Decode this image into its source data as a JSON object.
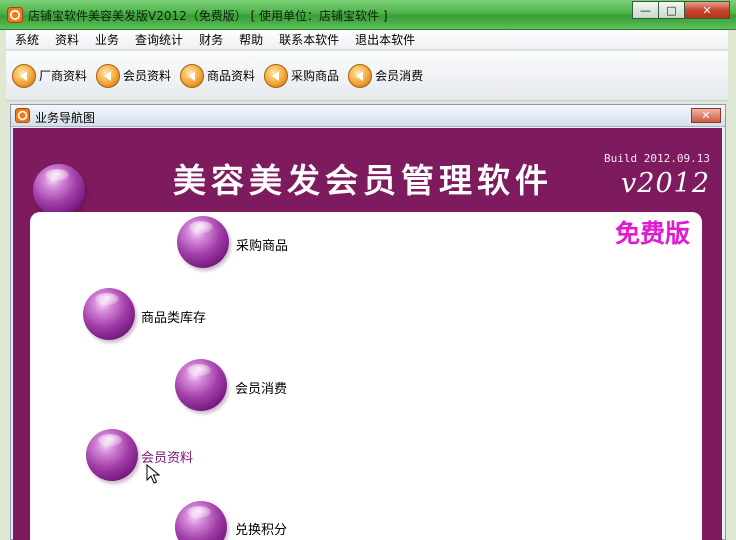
{
  "window": {
    "title": "店铺宝软件美容美发版V2012（免费版）   [ 使用单位：店铺宝软件 ]",
    "minimize_glyph": "—",
    "maximize_glyph": "□",
    "close_glyph": "✕"
  },
  "menu": [
    {
      "label": "系统"
    },
    {
      "label": "资料"
    },
    {
      "label": "业务"
    },
    {
      "label": "查询统计"
    },
    {
      "label": "财务"
    },
    {
      "label": "帮助"
    },
    {
      "label": "联系本软件"
    },
    {
      "label": "退出本软件"
    }
  ],
  "toolbar": [
    {
      "label": "厂商资料",
      "icon": "orange-arrow-icon"
    },
    {
      "label": "会员资料",
      "icon": "orange-arrow-icon"
    },
    {
      "label": "商品资料",
      "icon": "orange-arrow-icon"
    },
    {
      "label": "采购商品",
      "icon": "orange-arrow-icon"
    },
    {
      "label": "会员消费",
      "icon": "orange-arrow-icon"
    }
  ],
  "child_window": {
    "title": "业务导航图",
    "close_glyph": "✕"
  },
  "banner": {
    "title": "美容美发会员管理软件",
    "build": "Build 2012.09.13",
    "version": "v2012",
    "edition": "免费版"
  },
  "nav_items": [
    {
      "label": "采购商品",
      "active": false
    },
    {
      "label": "商品类库存",
      "active": false
    },
    {
      "label": "会员消费",
      "active": false
    },
    {
      "label": "会员资料",
      "active": true
    },
    {
      "label": "兑换积分",
      "active": false
    }
  ],
  "colors": {
    "titlebar_green": "#4bb348",
    "nav_background": "#7e1a5e",
    "edition_magenta": "#e01ad0",
    "orb_purple": "#a23ea9",
    "toolbar_orange": "#f2a634"
  }
}
